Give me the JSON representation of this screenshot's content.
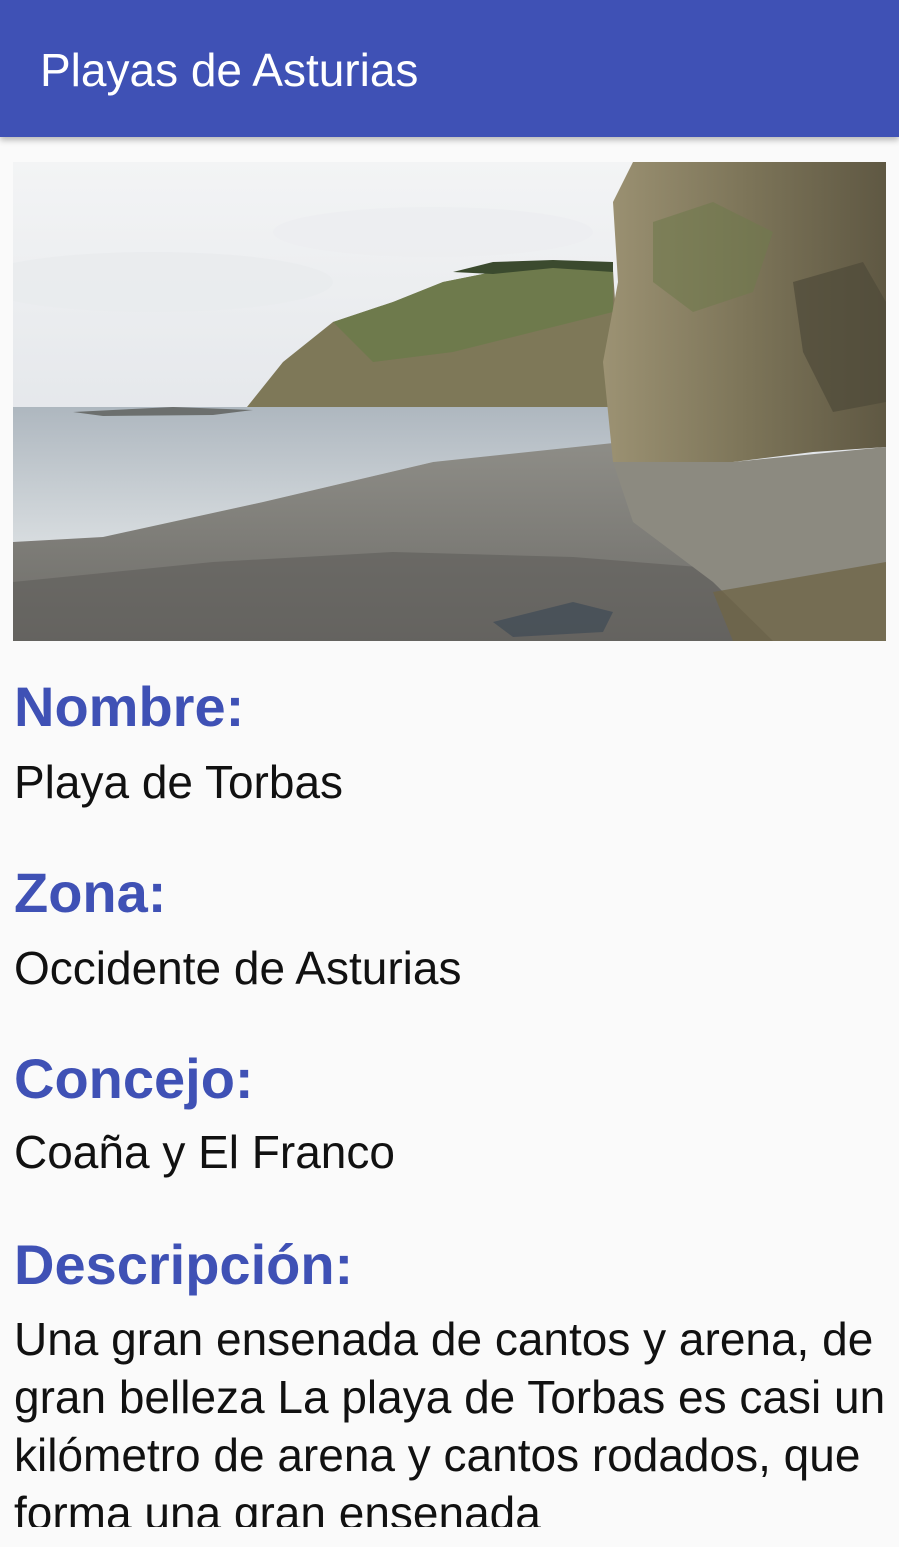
{
  "appbar": {
    "title": "Playas de Asturias",
    "background_color": "#3f51b5"
  },
  "beach": {
    "image": "beach-photo",
    "fields": [
      {
        "label": "Nombre:",
        "value": "Playa de Torbas"
      },
      {
        "label": "Zona:",
        "value": "Occidente de Asturias"
      },
      {
        "label": "Concejo:",
        "value": "Coaña y El Franco"
      },
      {
        "label": "Descripción:",
        "value": "Una gran ensenada de cantos y arena, de gran belleza La playa de Torbas es casi un kilómetro de arena y cantos rodados, que forma una gran ensenada"
      }
    ]
  },
  "colors": {
    "label": "#3f51b5",
    "text": "#111111",
    "background": "#fafafa"
  }
}
